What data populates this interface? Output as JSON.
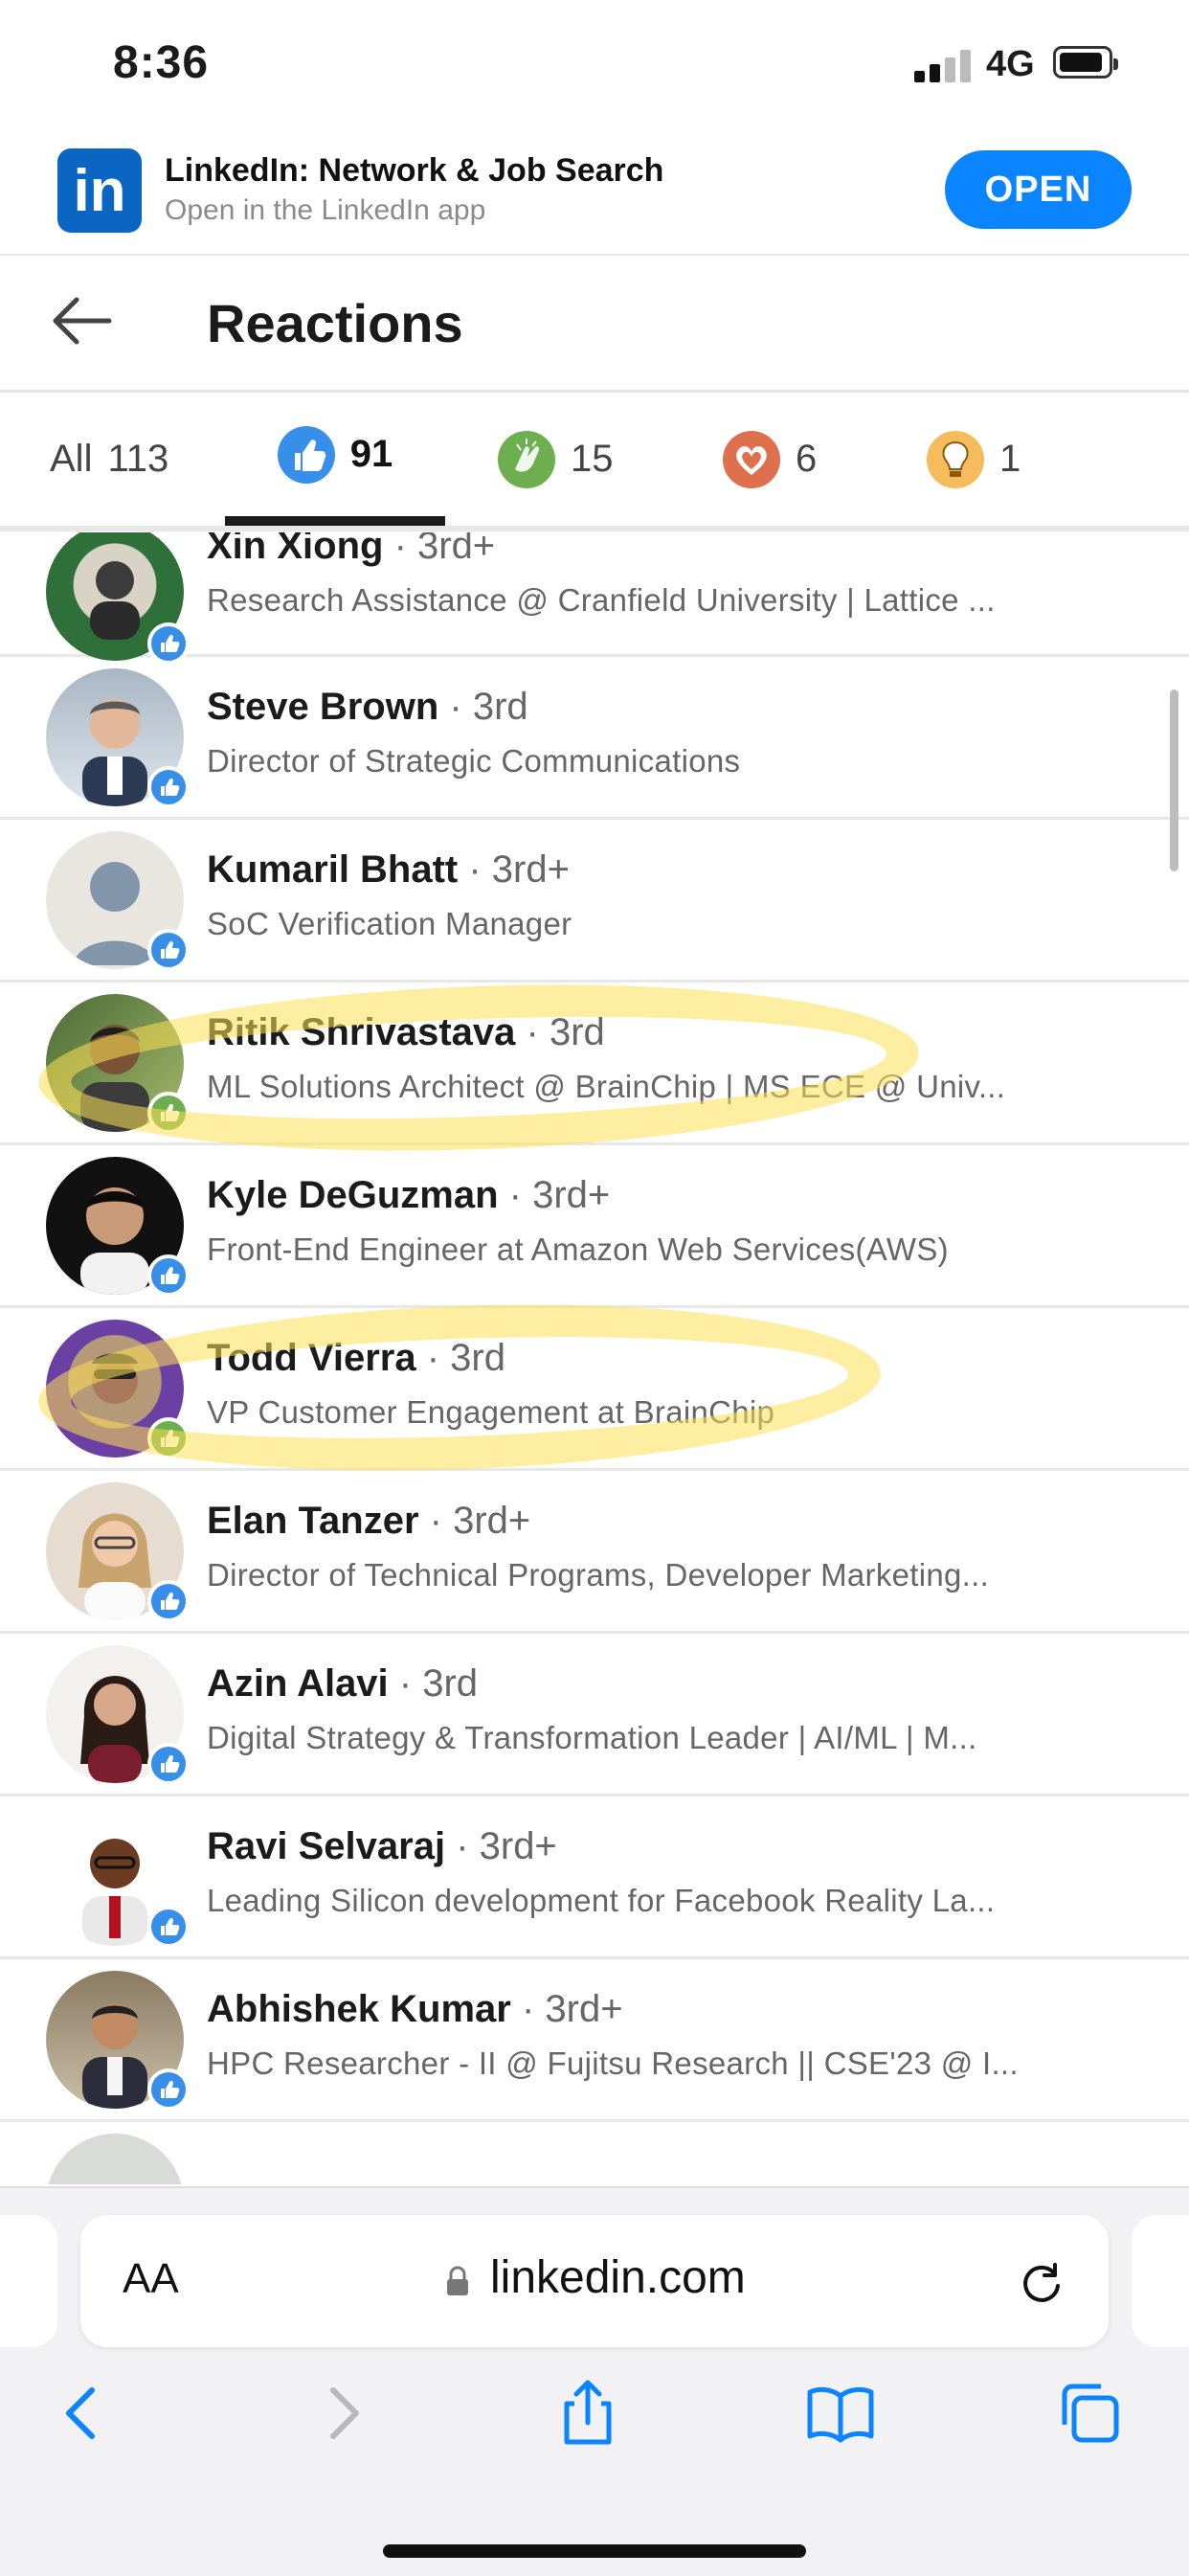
{
  "status_bar": {
    "time": "8:36",
    "network": "4G"
  },
  "app_banner": {
    "logo_text": "in",
    "title": "LinkedIn: Network & Job Search",
    "subtitle": "Open in the LinkedIn app",
    "open_label": "OPEN"
  },
  "header": {
    "title": "Reactions"
  },
  "tabs": [
    {
      "label": "All",
      "count": "113",
      "icon": null
    },
    {
      "label": "",
      "count": "91",
      "icon": "like-icon"
    },
    {
      "label": "",
      "count": "15",
      "icon": "celebrate-icon"
    },
    {
      "label": "",
      "count": "6",
      "icon": "love-icon"
    },
    {
      "label": "",
      "count": "1",
      "icon": "insightful-icon"
    }
  ],
  "people": [
    {
      "name": "Xin Xiong",
      "degree": "· 3rd+",
      "headline": "Research Assistance @ Cranfield University | Lattice ..."
    },
    {
      "name": "Steve Brown",
      "degree": "· 3rd",
      "headline": "Director of Strategic Communications"
    },
    {
      "name": "Kumaril Bhatt",
      "degree": "· 3rd+",
      "headline": "SoC Verification Manager"
    },
    {
      "name": "Ritik Shrivastava",
      "degree": "· 3rd",
      "headline": "ML Solutions Architect @ BrainChip | MS ECE @ Univ..."
    },
    {
      "name": "Kyle DeGuzman",
      "degree": "· 3rd+",
      "headline": "Front-End Engineer at Amazon Web Services(AWS)"
    },
    {
      "name": "Todd Vierra",
      "degree": "· 3rd",
      "headline": "VP Customer Engagement at BrainChip"
    },
    {
      "name": "Elan Tanzer",
      "degree": "· 3rd+",
      "headline": "Director of Technical Programs, Developer Marketing..."
    },
    {
      "name": "Azin Alavi",
      "degree": "· 3rd",
      "headline": "Digital Strategy & Transformation Leader | AI/ML | M..."
    },
    {
      "name": "Ravi Selvaraj",
      "degree": "· 3rd+",
      "headline": "Leading Silicon development for Facebook Reality La..."
    },
    {
      "name": "Abhishek Kumar",
      "degree": "· 3rd+",
      "headline": "HPC Researcher - II @ Fujitsu Research || CSE'23 @ I..."
    }
  ],
  "safari": {
    "text_size_label": "AA",
    "url": "linkedin.com"
  },
  "colors": {
    "linkedin_blue": "#0a66c2",
    "like_blue": "#378fe9",
    "celebrate_green": "#6dae4f",
    "love_red": "#df704d",
    "insightful_yellow": "#f5bb5c",
    "highlight_yellow": "#fde054",
    "safari_blue": "#0a84ff"
  }
}
